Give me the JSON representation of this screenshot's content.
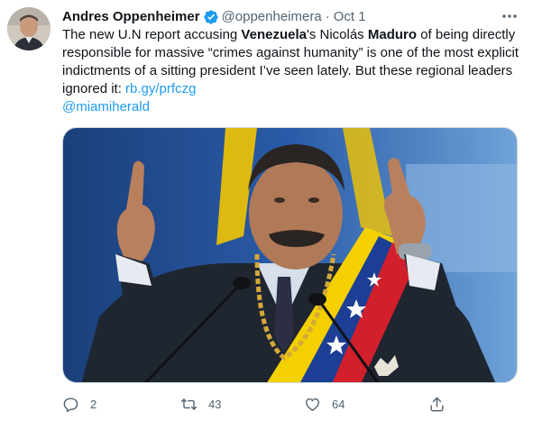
{
  "author": {
    "name": "Andres Oppenheimer",
    "handle": "@oppenheimera",
    "separator": "·",
    "date": "Oct 1"
  },
  "body": {
    "seg1": "The new U.N report accusing ",
    "seg2": "Venezuela",
    "seg3": "'s Nicolás ",
    "seg4": "Maduro",
    "seg5": " of being directly responsible for massive “crimes against humanity” is one of the most explicit indictments of a sitting president I’ve seen lately. But these regional leaders ignored it: ",
    "link": "rb.gy/prfczg",
    "mention": "@miamiherald"
  },
  "actions": {
    "reply_count": "2",
    "retweet_count": "43",
    "like_count": "64"
  },
  "colors": {
    "link": "#1d9bf0",
    "muted": "#536471",
    "verified": "#1d9bf0"
  },
  "icons": {
    "reply": "reply-icon",
    "retweet": "retweet-icon",
    "like": "heart-icon",
    "share": "share-icon",
    "more": "more-icon",
    "verified": "verified-badge-icon"
  }
}
